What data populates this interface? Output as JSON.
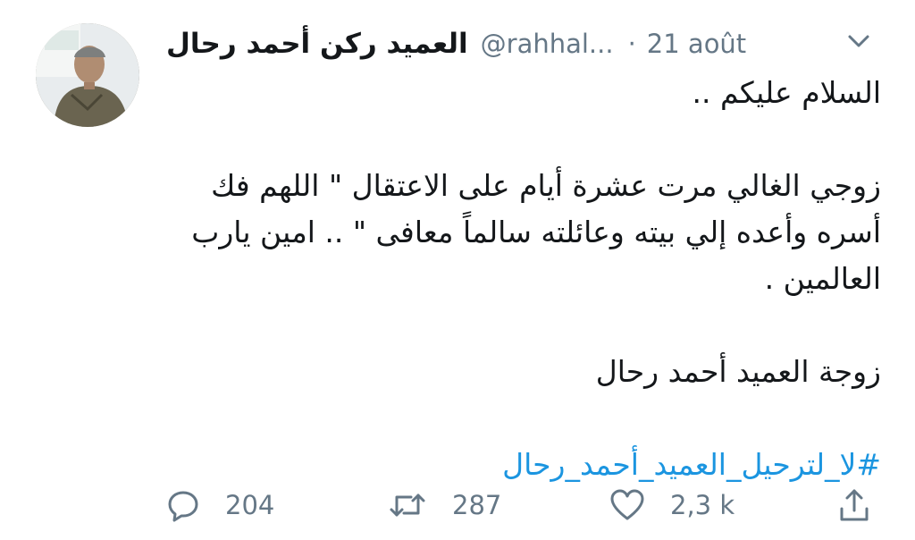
{
  "tweet": {
    "author_name": "العميد ركن أحمد رحال",
    "handle": "@rahhal...",
    "separator": "·",
    "date": "21 août",
    "lines": {
      "greeting": "السلام عليكم ..",
      "para1": "زوجي الغالي مرت عشرة أيام على الاعتقال \" اللهم فك أسره وأعده إلي بيته وعائلته سالماً معافى \" .. امين يارب العالمين .",
      "signature": "زوجة العميد أحمد رحال",
      "hashtag": "#لا_لترحيل_العميد_أحمد_رحال"
    },
    "stats": {
      "replies": "204",
      "retweets": "287",
      "likes": "2,3 k"
    }
  },
  "colors": {
    "text": "#14171a",
    "muted": "#657786",
    "link": "#1b95e0"
  },
  "icons": {
    "menu": "chevron-down-icon",
    "reply": "reply-bubble-icon",
    "retweet": "retweet-icon",
    "like": "heart-icon",
    "share": "share-icon"
  }
}
